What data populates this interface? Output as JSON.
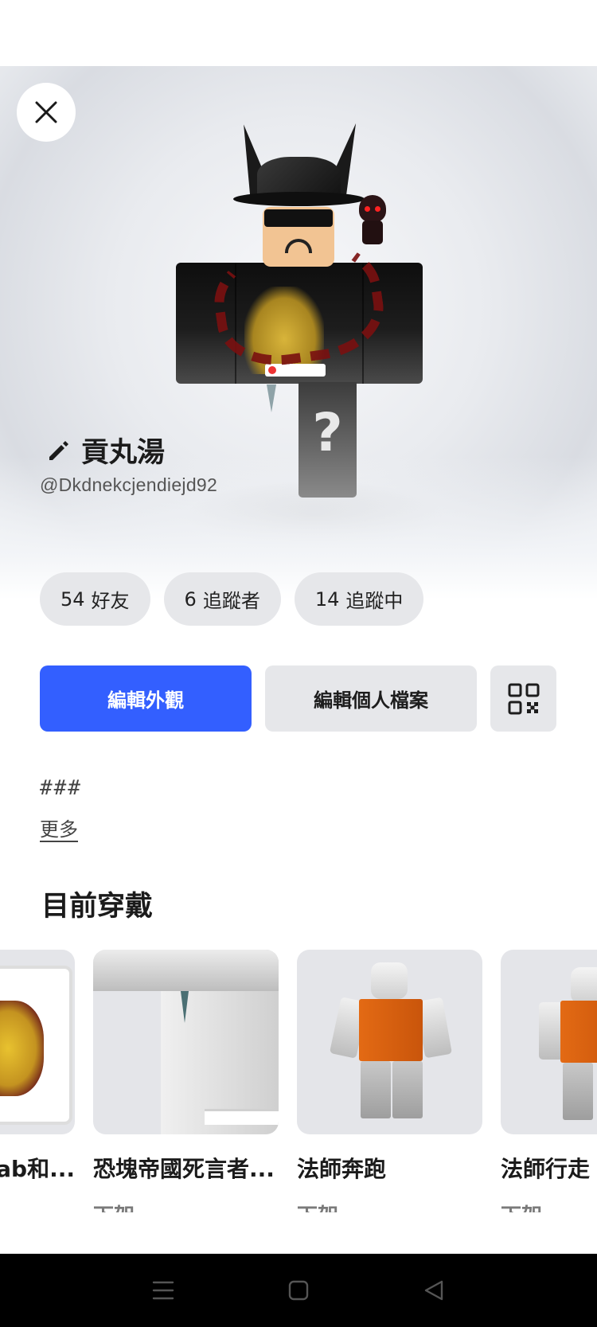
{
  "profile": {
    "display_name": "貢丸湯",
    "username": "@Dkdnekcjendiejd92"
  },
  "stats": [
    {
      "count": "54",
      "label": "好友"
    },
    {
      "count": "6",
      "label": "追蹤者"
    },
    {
      "count": "14",
      "label": "追蹤中"
    }
  ],
  "actions": {
    "edit_appearance": "編輯外觀",
    "edit_profile": "編輯個人檔案"
  },
  "bio": {
    "text": "###",
    "more_link": "更多"
  },
  "currently_wearing": {
    "title": "目前穿戴",
    "items": [
      {
        "title": "ab和...",
        "status": ""
      },
      {
        "title": "恐塊帝國死言者...",
        "status": "下架"
      },
      {
        "title": "法師奔跑",
        "status": "下架"
      },
      {
        "title": "法師行走",
        "status": "下架"
      }
    ]
  },
  "colors": {
    "primary_button": "#335fff",
    "pill_background": "#e6e7ea",
    "nav_bar": "#000000"
  },
  "icons": {
    "close": "close-icon",
    "edit": "pencil-icon",
    "qr": "qr-code-icon",
    "nav_menu": "menu-icon",
    "nav_home": "home-square-icon",
    "nav_back": "back-triangle-icon"
  }
}
